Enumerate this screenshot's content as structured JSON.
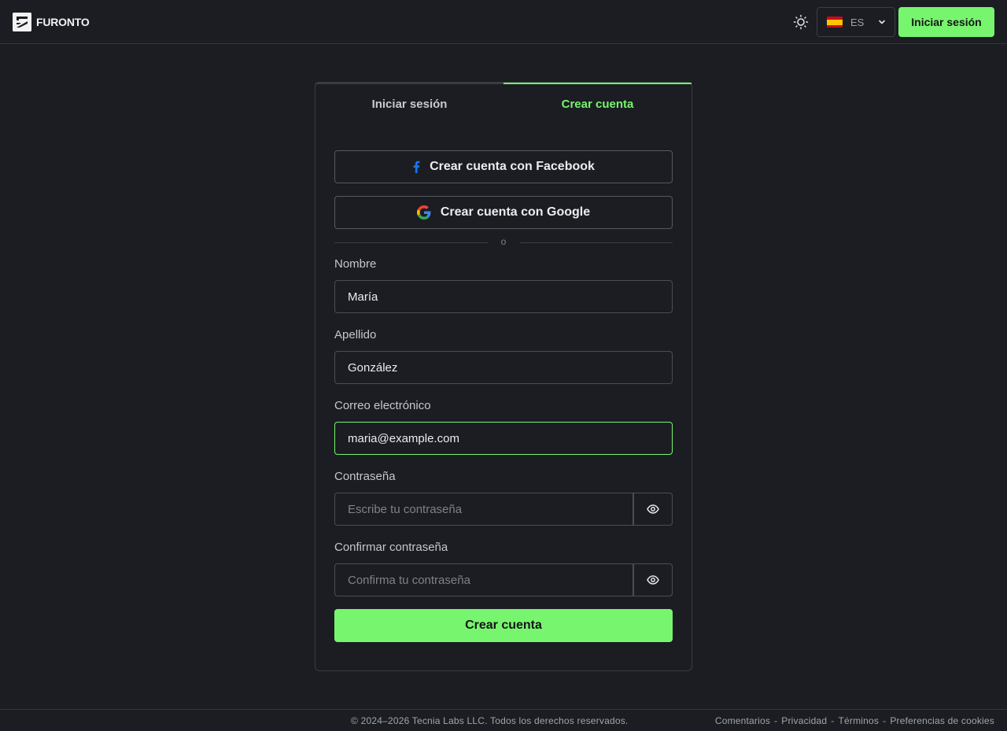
{
  "header": {
    "logo_text": "FURONTO",
    "language_code": "ES",
    "login_button": "Iniciar sesión"
  },
  "tabs": [
    {
      "label": "Iniciar sesión",
      "active": false
    },
    {
      "label": "Crear cuenta",
      "active": true
    }
  ],
  "social": {
    "facebook": "Crear cuenta con Facebook",
    "google": "Crear cuenta con Google"
  },
  "divider_text": "o",
  "form": {
    "first_name": {
      "label": "Nombre",
      "value": "María"
    },
    "last_name": {
      "label": "Apellido",
      "value": "González"
    },
    "email": {
      "label": "Correo electrónico",
      "value": "maria@example.com"
    },
    "password": {
      "label": "Contraseña",
      "placeholder": "Escribe tu contraseña"
    },
    "confirm_password": {
      "label": "Confirmar contraseña",
      "placeholder": "Confirma tu contraseña"
    },
    "submit": "Crear cuenta"
  },
  "footer": {
    "copyright": "© 2024–2026 Tecnia Labs LLC. Todos los derechos reservados.",
    "links": [
      "Comentarios",
      "Privacidad",
      "Términos",
      "Preferencias de cookies"
    ],
    "separator": "-"
  },
  "colors": {
    "accent": "#78f56e",
    "background": "#1b1d22"
  }
}
